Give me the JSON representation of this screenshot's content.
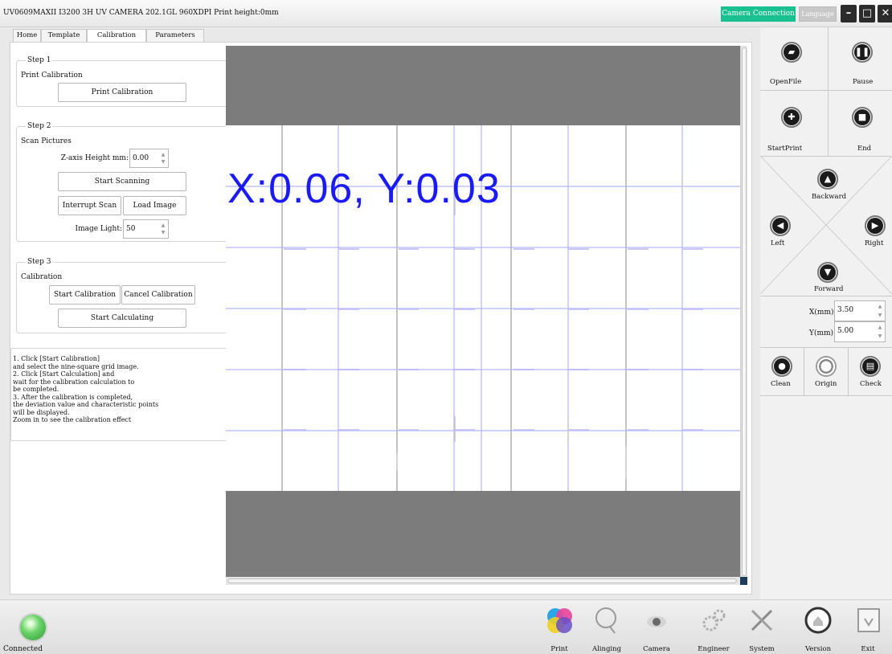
{
  "window": {
    "title": "UV0609MAXII I3200 3H UV CAMERA 202.1GL 960XDPI Print height:0mm",
    "camera_connection": "Camera Connection",
    "language": "Language",
    "minimize": "–",
    "maximize": "□",
    "close": "✕"
  },
  "tabs": [
    "Home",
    "Template",
    "Calibration",
    "Parameters"
  ],
  "active_tab": "Calibration",
  "step1": {
    "title": "Step 1",
    "label": "Print Calibration",
    "button": "Print Calibration"
  },
  "step2": {
    "title": "Step 2",
    "label": "Scan Pictures",
    "z_label": "Z-axis Height mm:",
    "z_value": "0.00",
    "start_scanning": "Start Scanning",
    "interrupt_scan": "Interrupt Scan",
    "load_image": "Load Image",
    "light_label": "Image Light:",
    "light_value": "50"
  },
  "step3": {
    "title": "Step 3",
    "label": "Calibration",
    "start_calibration": "Start Calibration",
    "cancel_calibration": "Cancel Calibration",
    "start_calculating": "Start Calculating"
  },
  "help": [
    "1. Click [Start Calibration]",
    "and select the nine-square grid image.",
    "2. Click [Start Calculation] and",
    "wait for the calibration calculation to",
    "be completed.",
    "3. After the calibration is completed,",
    "the deviation value and characteristic points",
    "will be displayed.",
    "Zoom in to see the calibration effect"
  ],
  "result_text": "X:0.06, Y:0.03",
  "control": {
    "openfile": "OpenFile",
    "pause": "Pause",
    "startprint": "StartPrint",
    "end": "End",
    "backward": "Backward",
    "left": "Left",
    "right": "Right",
    "forward": "Forward",
    "x_label": "X(mm)",
    "x_value": "3.50",
    "y_label": "Y(mm)",
    "y_value": "5.00",
    "clean": "Clean",
    "origin": "Origin",
    "check": "Check"
  },
  "status": {
    "label": "Connected"
  },
  "toolbar": {
    "print": "Print",
    "aligning": "Alinging",
    "camera": "Camera",
    "engineer": "Engineer",
    "system": "System",
    "version": "Version",
    "exit": "Exit"
  },
  "icons": {
    "openfile": "folder-icon",
    "pause": "pause-icon",
    "startprint": "print-icon",
    "end": "stop-icon",
    "backward": "arrow-up-icon",
    "left": "arrow-left-icon",
    "right": "arrow-right-icon",
    "forward": "arrow-down-icon",
    "clean": "drop-icon",
    "origin": "origin-icon",
    "check": "check-icon"
  },
  "colors": {
    "camera_connection": "#19c090",
    "result_text": "#1a1aff",
    "status_led": "#4cc04c",
    "viewer_bg": "#7c7c7c"
  }
}
